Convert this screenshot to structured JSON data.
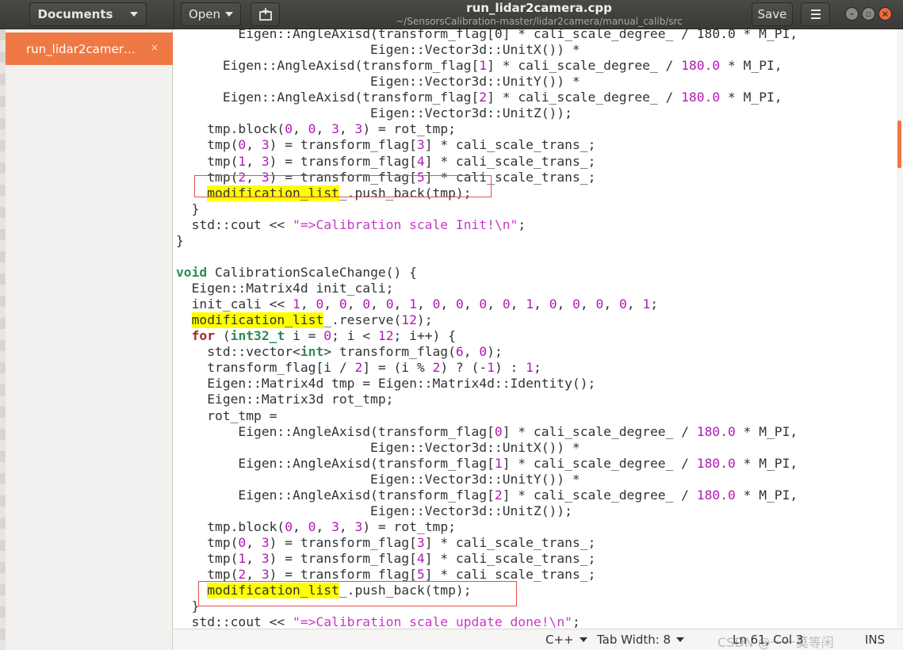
{
  "header": {
    "documents_label": "Documents",
    "open_label": "Open",
    "save_label": "Save",
    "title": "run_lidar2camera.cpp",
    "subtitle": "~/SensorsCalibration-master/lidar2camera/manual_calib/src"
  },
  "sidebar": {
    "documents": [
      {
        "name": "run_lidar2camer…",
        "close": "×"
      }
    ]
  },
  "editor": {
    "lines": [
      [
        [
          "Eigen::AngleAxisd(transform_flag[0] * cali_scale_degree_ / 180.0 * M_PI,",
          ""
        ]
      ],
      [
        [
          "                         Eigen::Vector3d::UnitX()) *",
          ""
        ]
      ],
      [
        [
          "      Eigen::AngleAxisd(transform_flag[",
          ""
        ],
        [
          "1",
          "num"
        ],
        [
          "] * cali_scale_degree_ / ",
          ""
        ],
        [
          "180.0",
          "num"
        ],
        [
          " * M_PI,",
          ""
        ]
      ],
      [
        [
          "                         Eigen::Vector3d::UnitY()) *",
          ""
        ]
      ],
      [
        [
          "      Eigen::AngleAxisd(transform_flag[",
          ""
        ],
        [
          "2",
          "num"
        ],
        [
          "] * cali_scale_degree_ / ",
          ""
        ],
        [
          "180.0",
          "num"
        ],
        [
          " * M_PI,",
          ""
        ]
      ],
      [
        [
          "                         Eigen::Vector3d::UnitZ());",
          ""
        ]
      ],
      [
        [
          "    tmp.block(",
          ""
        ],
        [
          "0",
          "num"
        ],
        [
          ", ",
          ""
        ],
        [
          "0",
          "num"
        ],
        [
          ", ",
          ""
        ],
        [
          "3",
          "num"
        ],
        [
          ", ",
          ""
        ],
        [
          "3",
          "num"
        ],
        [
          ") = rot_tmp;",
          ""
        ]
      ],
      [
        [
          "    tmp(",
          ""
        ],
        [
          "0",
          "num"
        ],
        [
          ", ",
          ""
        ],
        [
          "3",
          "num"
        ],
        [
          ") = transform_flag[",
          ""
        ],
        [
          "3",
          "num"
        ],
        [
          "] * cali_scale_trans_;",
          ""
        ]
      ],
      [
        [
          "    tmp(",
          ""
        ],
        [
          "1",
          "num"
        ],
        [
          ", ",
          ""
        ],
        [
          "3",
          "num"
        ],
        [
          ") = transform_flag[",
          ""
        ],
        [
          "4",
          "num"
        ],
        [
          "] * cali_scale_trans_;",
          ""
        ]
      ],
      [
        [
          "    tmp(",
          ""
        ],
        [
          "2",
          "num"
        ],
        [
          ", ",
          ""
        ],
        [
          "3",
          "num"
        ],
        [
          ") = transform_flag[",
          ""
        ],
        [
          "5",
          "num"
        ],
        [
          "] * cali_scale_trans_;",
          ""
        ]
      ],
      [
        [
          "    ",
          ""
        ],
        [
          "modification_list",
          "hl"
        ],
        [
          "_.push_back(tmp);",
          ""
        ]
      ],
      [
        [
          "  }",
          ""
        ]
      ],
      [
        [
          "  std::cout << ",
          ""
        ],
        [
          "\"=>Calibration scale Init!\\n\"",
          "str"
        ],
        [
          ";",
          ""
        ]
      ],
      [
        [
          "}",
          ""
        ]
      ],
      [
        [
          "",
          ""
        ]
      ],
      [
        [
          "void",
          "ty"
        ],
        [
          " CalibrationScaleChange() {",
          ""
        ]
      ],
      [
        [
          "  Eigen::Matrix4d init_cali;",
          ""
        ]
      ],
      [
        [
          "  init_cali << ",
          ""
        ],
        [
          "1",
          "num"
        ],
        [
          ", ",
          ""
        ],
        [
          "0",
          "num"
        ],
        [
          ", ",
          ""
        ],
        [
          "0",
          "num"
        ],
        [
          ", ",
          ""
        ],
        [
          "0",
          "num"
        ],
        [
          ", ",
          ""
        ],
        [
          "0",
          "num"
        ],
        [
          ", ",
          ""
        ],
        [
          "1",
          "num"
        ],
        [
          ", ",
          ""
        ],
        [
          "0",
          "num"
        ],
        [
          ", ",
          ""
        ],
        [
          "0",
          "num"
        ],
        [
          ", ",
          ""
        ],
        [
          "0",
          "num"
        ],
        [
          ", ",
          ""
        ],
        [
          "0",
          "num"
        ],
        [
          ", ",
          ""
        ],
        [
          "1",
          "num"
        ],
        [
          ", ",
          ""
        ],
        [
          "0",
          "num"
        ],
        [
          ", ",
          ""
        ],
        [
          "0",
          "num"
        ],
        [
          ", ",
          ""
        ],
        [
          "0",
          "num"
        ],
        [
          ", ",
          ""
        ],
        [
          "0",
          "num"
        ],
        [
          ", ",
          ""
        ],
        [
          "1",
          "num"
        ],
        [
          ";",
          ""
        ]
      ],
      [
        [
          "  ",
          ""
        ],
        [
          "modification_list",
          "hl"
        ],
        [
          "_.reserve(",
          ""
        ],
        [
          "12",
          "num"
        ],
        [
          ");",
          ""
        ]
      ],
      [
        [
          "  ",
          ""
        ],
        [
          "for",
          "kw"
        ],
        [
          " (",
          ""
        ],
        [
          "int32_t",
          "ty"
        ],
        [
          " i = ",
          ""
        ],
        [
          "0",
          "num"
        ],
        [
          "; i < ",
          ""
        ],
        [
          "12",
          "num"
        ],
        [
          "; i++) {",
          ""
        ]
      ],
      [
        [
          "    std::vector<",
          ""
        ],
        [
          "int",
          "ty"
        ],
        [
          "> transform_flag(",
          ""
        ],
        [
          "6",
          "num"
        ],
        [
          ", ",
          ""
        ],
        [
          "0",
          "num"
        ],
        [
          ");",
          ""
        ]
      ],
      [
        [
          "    transform_flag[i / ",
          ""
        ],
        [
          "2",
          "num"
        ],
        [
          "] = (i % ",
          ""
        ],
        [
          "2",
          "num"
        ],
        [
          ") ? (-",
          ""
        ],
        [
          "1",
          "num"
        ],
        [
          ") : ",
          ""
        ],
        [
          "1",
          "num"
        ],
        [
          ";",
          ""
        ]
      ],
      [
        [
          "    Eigen::Matrix4d tmp = Eigen::Matrix4d::Identity();",
          ""
        ]
      ],
      [
        [
          "    Eigen::Matrix3d rot_tmp;",
          ""
        ]
      ],
      [
        [
          "    rot_tmp =",
          ""
        ]
      ],
      [
        [
          "        Eigen::AngleAxisd(transform_flag[",
          ""
        ],
        [
          "0",
          "num"
        ],
        [
          "] * cali_scale_degree_ / ",
          ""
        ],
        [
          "180.0",
          "num"
        ],
        [
          " * M_PI,",
          ""
        ]
      ],
      [
        [
          "                         Eigen::Vector3d::UnitX()) *",
          ""
        ]
      ],
      [
        [
          "        Eigen::AngleAxisd(transform_flag[",
          ""
        ],
        [
          "1",
          "num"
        ],
        [
          "] * cali_scale_degree_ / ",
          ""
        ],
        [
          "180.0",
          "num"
        ],
        [
          " * M_PI,",
          ""
        ]
      ],
      [
        [
          "                         Eigen::Vector3d::UnitY()) *",
          ""
        ]
      ],
      [
        [
          "        Eigen::AngleAxisd(transform_flag[",
          ""
        ],
        [
          "2",
          "num"
        ],
        [
          "] * cali_scale_degree_ / ",
          ""
        ],
        [
          "180.0",
          "num"
        ],
        [
          " * M_PI,",
          ""
        ]
      ],
      [
        [
          "                         Eigen::Vector3d::UnitZ());",
          ""
        ]
      ],
      [
        [
          "    tmp.block(",
          ""
        ],
        [
          "0",
          "num"
        ],
        [
          ", ",
          ""
        ],
        [
          "0",
          "num"
        ],
        [
          ", ",
          ""
        ],
        [
          "3",
          "num"
        ],
        [
          ", ",
          ""
        ],
        [
          "3",
          "num"
        ],
        [
          ") = rot_tmp;",
          ""
        ]
      ],
      [
        [
          "    tmp(",
          ""
        ],
        [
          "0",
          "num"
        ],
        [
          ", ",
          ""
        ],
        [
          "3",
          "num"
        ],
        [
          ") = transform_flag[",
          ""
        ],
        [
          "3",
          "num"
        ],
        [
          "] * cali_scale_trans_;",
          ""
        ]
      ],
      [
        [
          "    tmp(",
          ""
        ],
        [
          "1",
          "num"
        ],
        [
          ", ",
          ""
        ],
        [
          "3",
          "num"
        ],
        [
          ") = transform_flag[",
          ""
        ],
        [
          "4",
          "num"
        ],
        [
          "] * cali_scale_trans_;",
          ""
        ]
      ],
      [
        [
          "    tmp(",
          ""
        ],
        [
          "2",
          "num"
        ],
        [
          ", ",
          ""
        ],
        [
          "3",
          "num"
        ],
        [
          ") = transform_flag[",
          ""
        ],
        [
          "5",
          "num"
        ],
        [
          "] * cali_scale_trans_;",
          ""
        ]
      ],
      [
        [
          "    ",
          ""
        ],
        [
          "modification_list",
          "hl"
        ],
        [
          "_.push_back(tmp);",
          ""
        ]
      ],
      [
        [
          "  }",
          ""
        ]
      ],
      [
        [
          "  std::cout << ",
          ""
        ],
        [
          "\"=>Calibration scale update done!\\n\"",
          "str"
        ],
        [
          ";",
          ""
        ]
      ]
    ]
  },
  "statusbar": {
    "language": "C++",
    "tab_width": "Tab Width: 8",
    "position": "Ln 61, Col 3",
    "mode": "INS",
    "watermark": "CSDN @一一莫等闲"
  }
}
